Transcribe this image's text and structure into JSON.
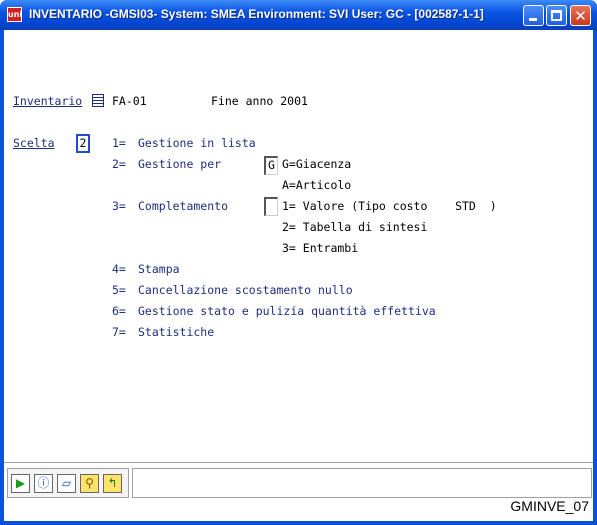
{
  "window": {
    "title": "INVENTARIO -GMSI03- System: SMEA Environment: SVI User: GC - [002587-1-1]",
    "app_icon_text": "uni",
    "minimize_icon": "minimize-icon",
    "maximize_icon": "maximize-icon",
    "close_icon": "close-icon"
  },
  "form": {
    "inventario_label": "Inventario",
    "inventario_code": "FA-01",
    "inventario_desc": "Fine anno 2001",
    "scelta_label": "Scelta",
    "scelta_value": "2",
    "options": [
      {
        "key": "1=",
        "label": "Gestione in lista"
      },
      {
        "key": "2=",
        "label": "Gestione per"
      },
      {
        "key": "3=",
        "label": "Completamento"
      },
      {
        "key": "4=",
        "label": "Stampa"
      },
      {
        "key": "5=",
        "label": "Cancellazione scostamento nullo"
      },
      {
        "key": "6=",
        "label": "Gestione stato e pulizia quantità effettiva"
      },
      {
        "key": "7=",
        "label": "Statistiche"
      }
    ],
    "gestione_per_value": "G",
    "gestione_per_sub": [
      "G=Giacenza",
      "A=Articolo"
    ],
    "completamento_value": "",
    "completamento_sub": [
      "1= Valore (Tipo costo    STD  )",
      "2= Tabella di sintesi",
      "3= Entrambi"
    ]
  },
  "toolbar": {
    "buttons": [
      {
        "name": "run-icon",
        "glyph": "▶",
        "color": "#1a9a1a"
      },
      {
        "name": "info-icon",
        "glyph": "ⓘ",
        "color": "#1f4ec8"
      },
      {
        "name": "eraser-icon",
        "glyph": "▱",
        "color": "#1f4ec8"
      },
      {
        "name": "search-icon",
        "glyph": "⚲",
        "color": "#c08a00"
      },
      {
        "name": "back-icon",
        "glyph": "↰",
        "color": "#1a7a1a"
      }
    ]
  },
  "status": {
    "program_id": "GMINVE_07"
  }
}
